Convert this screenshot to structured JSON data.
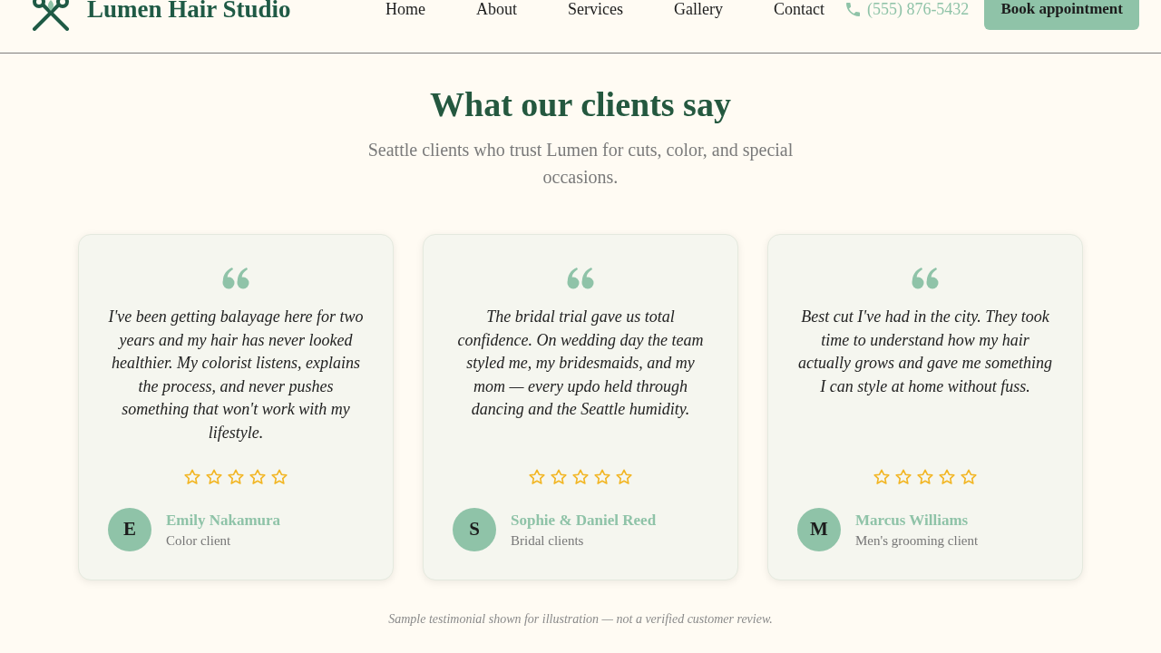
{
  "header": {
    "brand": "Lumen Hair Studio",
    "nav": [
      "Home",
      "About",
      "Services",
      "Gallery",
      "Contact"
    ],
    "phone": "(555) 876-5432",
    "cta": "Book appointment"
  },
  "testimonials_section": {
    "title": "What our clients say",
    "subtitle": "Seattle clients who trust Lumen for cuts, color, and special occasions.",
    "testimonials": [
      {
        "quote": "I've been getting balayage here for two years and my hair has never looked healthier. My colorist listens, explains the process, and never pushes something that won't work with my lifestyle.",
        "stars": 0,
        "initial": "E",
        "name": "Emily Nakamura",
        "role": "Color client"
      },
      {
        "quote": "The bridal trial gave us total confidence. On wedding day the team styled me, my bridesmaids, and my mom — every updo held through dancing and the Seattle humidity.",
        "stars": 0,
        "initial": "S",
        "name": "Sophie & Daniel Reed",
        "role": "Bridal clients"
      },
      {
        "quote": "Best cut I've had in the city. They took time to understand how my hair actually grows and gave me something I can style at home without fuss.",
        "stars": 0,
        "initial": "M",
        "name": "Marcus Williams",
        "role": "Men's grooming client"
      }
    ],
    "disclaimer": "Sample testimonial shown for illustration — not a verified customer review."
  }
}
